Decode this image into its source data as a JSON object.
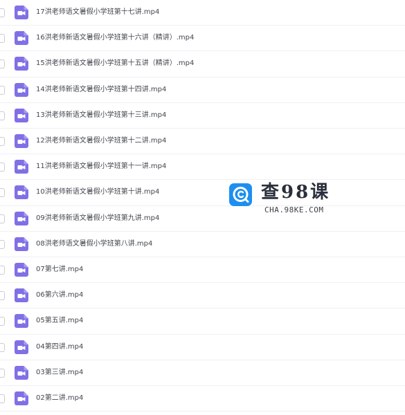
{
  "colors": {
    "file_icon": "#8070e6",
    "file_icon_glyph": "#ffffff",
    "filename_text": "#41464d",
    "row_divider": "#eef0f3",
    "watermark_logo": "#1d8ff0"
  },
  "files": [
    {
      "name": "17洪老师语文暑假小学班第十七讲.mp4",
      "icon": "video-file-icon",
      "checked": false
    },
    {
      "name": "16洪老师新语文暑假小学班第十六讲（精讲）.mp4",
      "icon": "video-file-icon",
      "checked": false
    },
    {
      "name": "15洪老师新语文暑假小学班第十五讲（精讲）.mp4",
      "icon": "video-file-icon",
      "checked": false
    },
    {
      "name": "14洪老师新语文暑假小学班第十四讲.mp4",
      "icon": "video-file-icon",
      "checked": false
    },
    {
      "name": "13洪老师新语文暑假小学班第十三讲.mp4",
      "icon": "video-file-icon",
      "checked": false
    },
    {
      "name": "12洪老师新语文暑假小学班第十二讲.mp4",
      "icon": "video-file-icon",
      "checked": false
    },
    {
      "name": "11洪老师新语文暑假小学班第十一讲.mp4",
      "icon": "video-file-icon",
      "checked": false
    },
    {
      "name": "10洪老师新语文暑假小学班第十讲.mp4",
      "icon": "video-file-icon",
      "checked": false
    },
    {
      "name": "09洪老师新语文暑假小学班第九讲.mp4",
      "icon": "video-file-icon",
      "checked": false
    },
    {
      "name": "08洪老师语文暑假小学班第八讲.mp4",
      "icon": "video-file-icon",
      "checked": false
    },
    {
      "name": "07第七讲.mp4",
      "icon": "video-file-icon",
      "checked": false
    },
    {
      "name": "06第六讲.mp4",
      "icon": "video-file-icon",
      "checked": false
    },
    {
      "name": "05第五讲.mp4",
      "icon": "video-file-icon",
      "checked": false
    },
    {
      "name": "04第四讲.mp4",
      "icon": "video-file-icon",
      "checked": false
    },
    {
      "name": "03第三讲.mp4",
      "icon": "video-file-icon",
      "checked": false
    },
    {
      "name": "02第二讲.mp4",
      "icon": "video-file-icon",
      "checked": false
    }
  ],
  "watermark": {
    "title": "查98课",
    "url": "CHA.98KE.COM",
    "logo_icon": "search-c-logo-icon"
  }
}
